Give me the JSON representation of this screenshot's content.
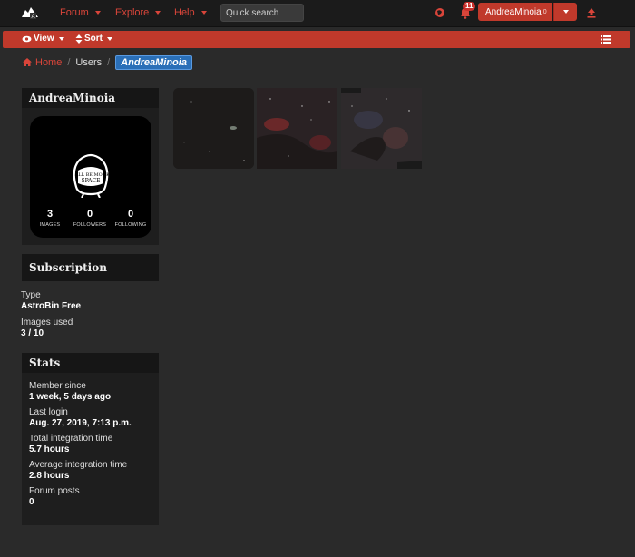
{
  "nav": {
    "forum": "Forum",
    "explore": "Explore",
    "help": "Help",
    "search_placeholder": "Quick search",
    "notifications_count": "11",
    "username": "AndreaMinoia",
    "user_dot": "0"
  },
  "subbar": {
    "view": "View",
    "sort": "Sort"
  },
  "breadcrumb": {
    "home": "Home",
    "users": "Users",
    "current": "AndreaMinoia"
  },
  "profile": {
    "name": "AndreaMinoia",
    "images_count": "3",
    "images_label": "IMAGES",
    "followers_count": "0",
    "followers_label": "FOLLOWERS",
    "following_count": "0",
    "following_label": "FOLLOWING",
    "avatar_text": "I ALL BE MONK SPACE"
  },
  "subscription": {
    "title": "Subscription",
    "type_label": "Type",
    "type_value": "AstroBin Free",
    "images_used_label": "Images used",
    "images_used_value": "3 / 10"
  },
  "stats": {
    "title": "Stats",
    "member_since_label": "Member since",
    "member_since_value": "1 week, 5 days ago",
    "last_login_label": "Last login",
    "last_login_value": "Aug. 27, 2019, 7:13 p.m.",
    "total_integration_label": "Total integration time",
    "total_integration_value": "5.7 hours",
    "avg_integration_label": "Average integration time",
    "avg_integration_value": "2.8 hours",
    "forum_posts_label": "Forum posts",
    "forum_posts_value": "0"
  },
  "colors": {
    "accent": "#c0392b",
    "link": "#d9453a",
    "breadcrumb_active": "#2a6fb8",
    "background": "#2a2a2a"
  }
}
